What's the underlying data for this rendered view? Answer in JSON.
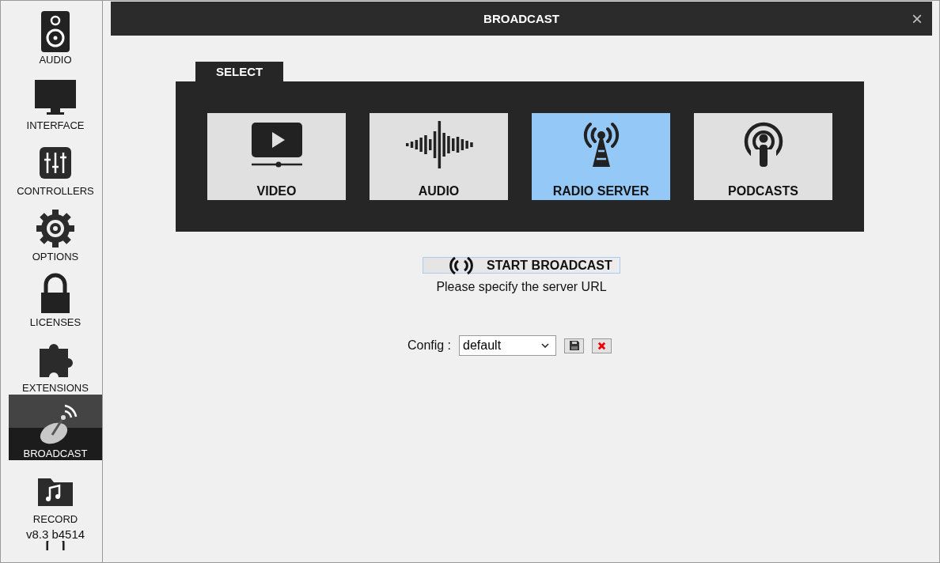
{
  "sidebar": {
    "items": [
      {
        "label": "AUDIO",
        "selected": false
      },
      {
        "label": "INTERFACE",
        "selected": false
      },
      {
        "label": "CONTROLLERS",
        "selected": false
      },
      {
        "label": "OPTIONS",
        "selected": false
      },
      {
        "label": "LICENSES",
        "selected": false
      },
      {
        "label": "EXTENSIONS",
        "selected": false
      },
      {
        "label": "BROADCAST",
        "selected": true
      },
      {
        "label": "RECORD",
        "selected": false
      }
    ],
    "version": "v8.3 b4514"
  },
  "window": {
    "title": "BROADCAST",
    "close": "×"
  },
  "tab": {
    "label": "SELECT"
  },
  "options": [
    {
      "label": "VIDEO",
      "selected": false
    },
    {
      "label": "AUDIO",
      "selected": false
    },
    {
      "label": "RADIO SERVER",
      "selected": true
    },
    {
      "label": "PODCASTS",
      "selected": false
    }
  ],
  "start_button": {
    "label": "START BROADCAST"
  },
  "message": "Please specify the server URL",
  "config": {
    "label": "Config :",
    "value": "default"
  }
}
